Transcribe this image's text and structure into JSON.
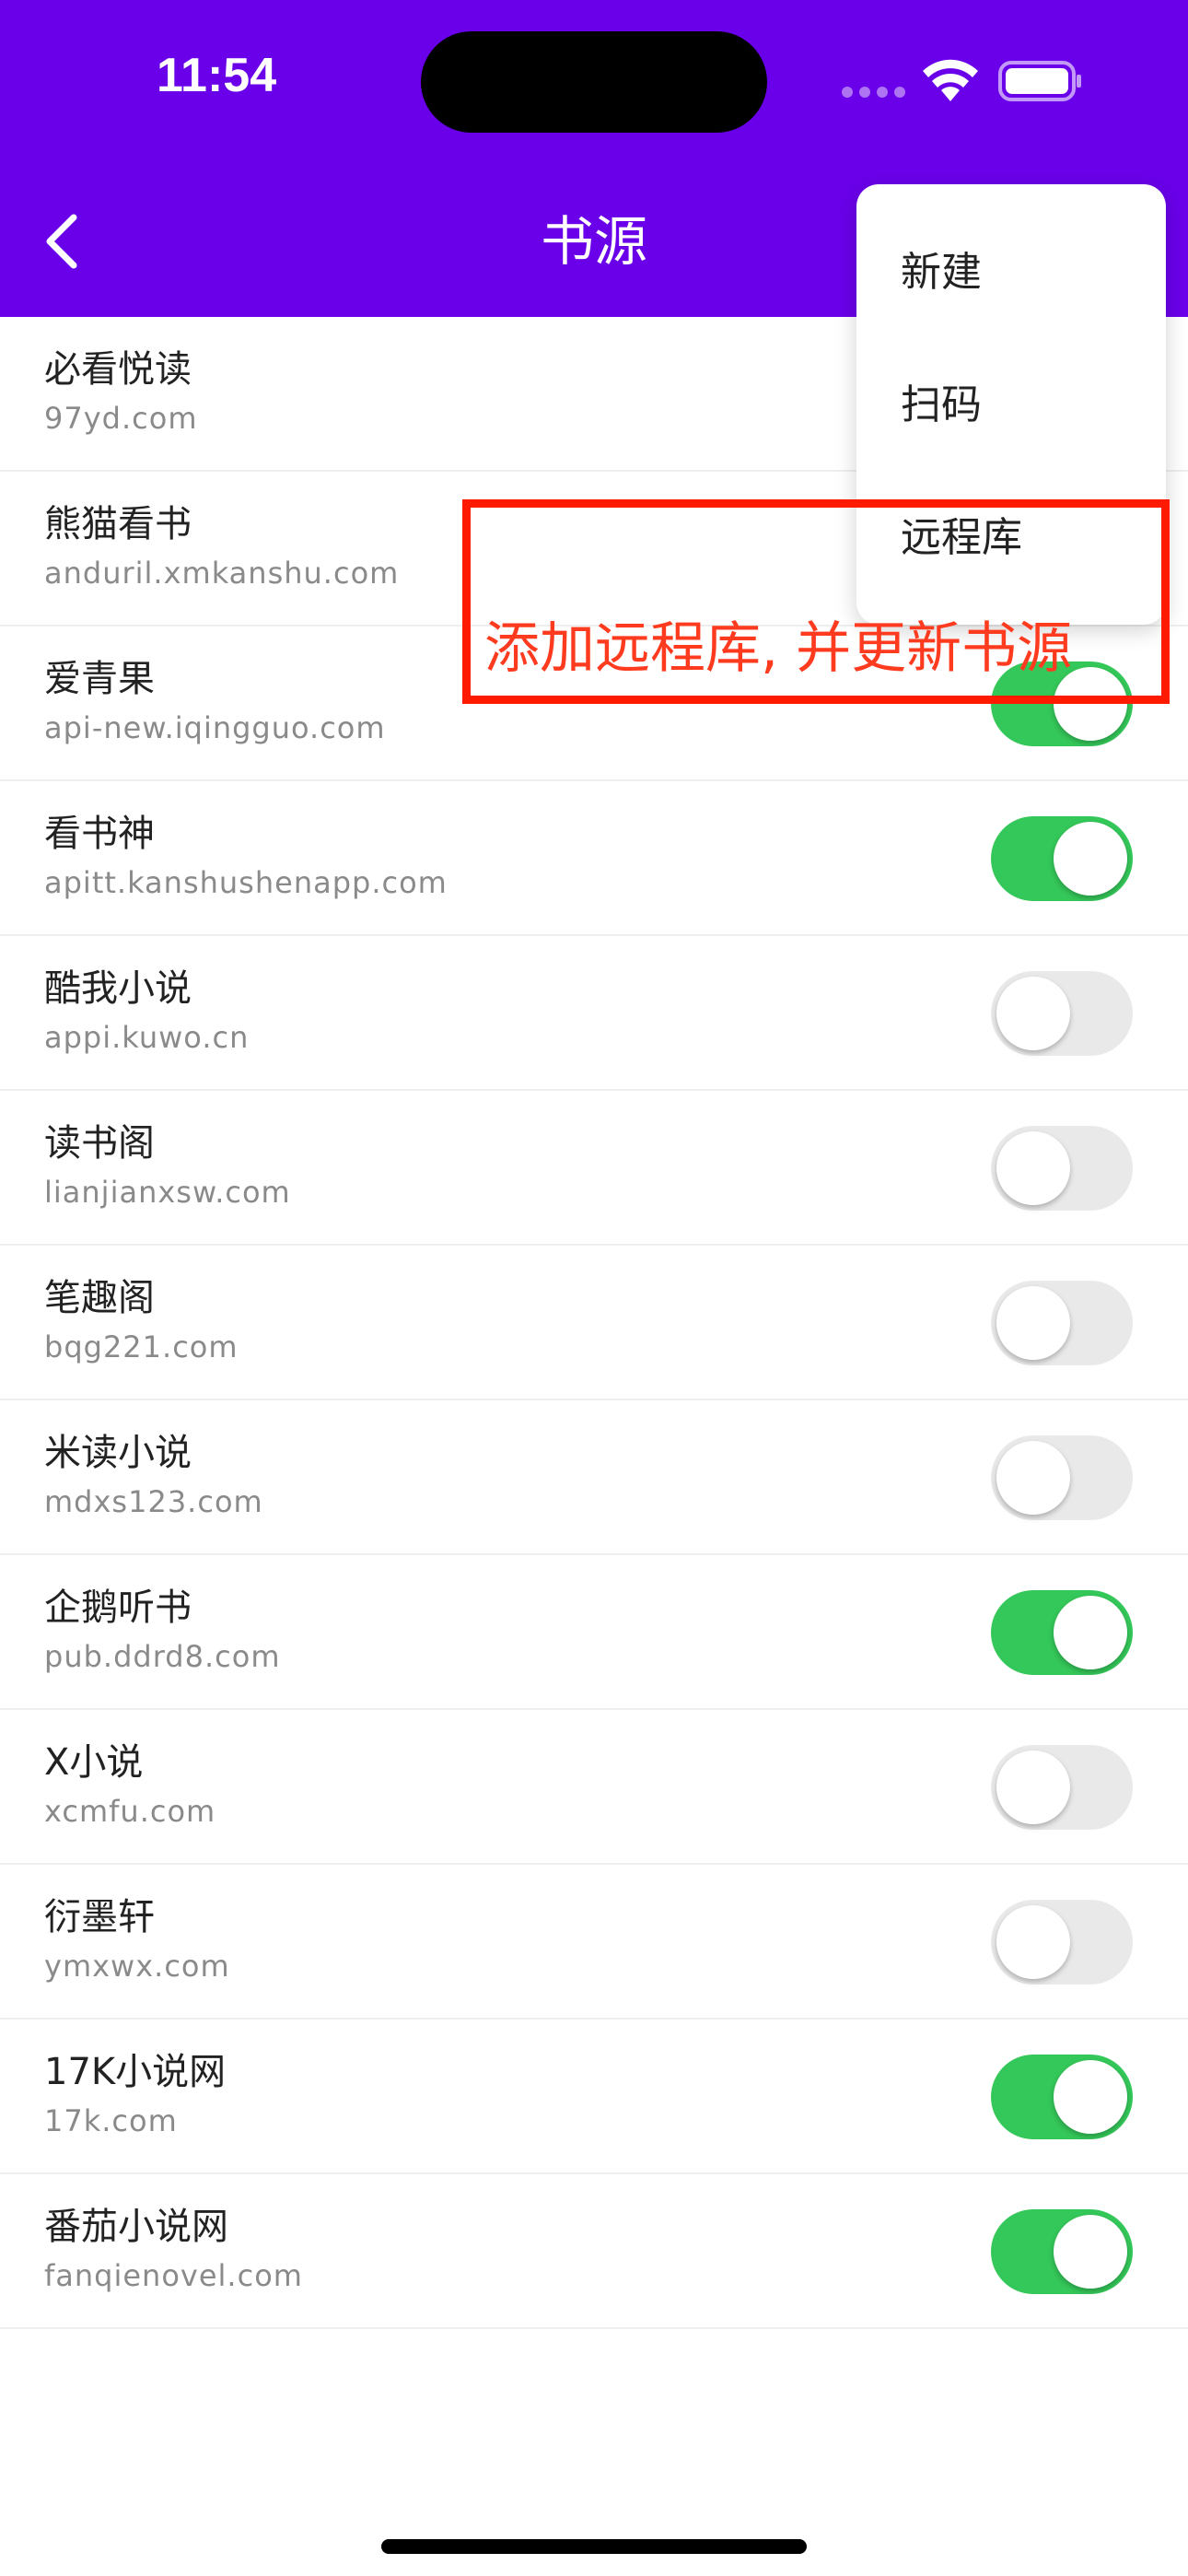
{
  "status_bar": {
    "time": "11:54",
    "wifi_icon": "wifi-icon",
    "battery_icon": "battery-icon",
    "battery_level": 1.0
  },
  "header": {
    "title": "书源",
    "back_icon": "chevron-left-icon",
    "background_color": "#6a00ea"
  },
  "menu": {
    "items": [
      {
        "label": "新建"
      },
      {
        "label": "扫码"
      },
      {
        "label": "远程库"
      }
    ]
  },
  "annotation": {
    "text": "添加远程库, 并更新书源",
    "color": "#ff1a00"
  },
  "sources": [
    {
      "name": "必看悦读",
      "domain": "97yd.com",
      "enabled": null
    },
    {
      "name": "熊猫看书",
      "domain": "anduril.xmkanshu.com",
      "enabled": null
    },
    {
      "name": "爱青果",
      "domain": "api-new.iqingguo.com",
      "enabled": true
    },
    {
      "name": "看书神",
      "domain": "apitt.kanshushenapp.com",
      "enabled": true
    },
    {
      "name": "酷我小说",
      "domain": "appi.kuwo.cn",
      "enabled": false
    },
    {
      "name": "读书阁",
      "domain": "lianjianxsw.com",
      "enabled": false
    },
    {
      "name": "笔趣阁",
      "domain": "bqg221.com",
      "enabled": false
    },
    {
      "name": "米读小说",
      "domain": "mdxs123.com",
      "enabled": false
    },
    {
      "name": "企鹅听书",
      "domain": "pub.ddrd8.com",
      "enabled": true
    },
    {
      "name": "X小说",
      "domain": "xcmfu.com",
      "enabled": false
    },
    {
      "name": "衍墨轩",
      "domain": "ymxwx.com",
      "enabled": false
    },
    {
      "name": "17K小说网",
      "domain": "17k.com",
      "enabled": true
    },
    {
      "name": "番茄小说网",
      "domain": "fanqienovel.com",
      "enabled": true
    }
  ],
  "colors": {
    "toggle_on": "#34c759",
    "toggle_off": "#e9e9ea"
  }
}
